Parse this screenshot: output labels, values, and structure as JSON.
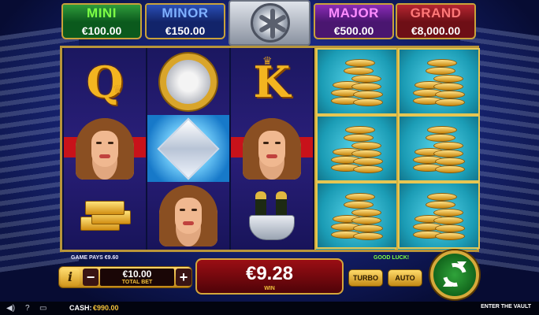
{
  "jackpots": [
    {
      "name": "MINI",
      "value": "€100.00"
    },
    {
      "name": "MINOR",
      "value": "€150.00"
    },
    {
      "name": "MAJOR",
      "value": "€500.00"
    },
    {
      "name": "GRAND",
      "value": "€8,000.00"
    }
  ],
  "reels": {
    "reel1": [
      "letter-q",
      "woman",
      "gold-bars"
    ],
    "reel2": [
      "gold-watch",
      "diamond",
      "woman"
    ],
    "reel3": [
      "letter-k",
      "woman",
      "champagne-bucket"
    ],
    "reel4": [
      "gold-coins",
      "gold-coins",
      "gold-coins"
    ],
    "reel5": [
      "gold-coins",
      "gold-coins",
      "gold-coins"
    ],
    "letter_q": "Q",
    "letter_k": "K"
  },
  "messages": {
    "game_pays": "GAME PAYS €9.60",
    "good_luck": "GOOD LUCK!"
  },
  "bet": {
    "info_label": "i",
    "minus_label": "−",
    "plus_label": "+",
    "value": "€10.00",
    "label": "TOTAL BET"
  },
  "win": {
    "value": "€9.28",
    "label": "WIN"
  },
  "controls": {
    "turbo_label": "TURBO",
    "auto_label": "AUTO",
    "spin_icon": "spin-arrows-icon"
  },
  "statusbar": {
    "sound_icon": "speaker-icon",
    "help_icon": "question-icon",
    "paytable_icon": "paytable-icon",
    "cash_label": "CASH:",
    "cash_value": "€990.00",
    "game_title": "ENTER THE VAULT"
  },
  "colors": {
    "mini": "#0b5a1d",
    "minor": "#12246a",
    "major": "#4a1670",
    "grand": "#6e0f16",
    "gold": "#d4a73b",
    "spin_green": "#2fa33a"
  }
}
